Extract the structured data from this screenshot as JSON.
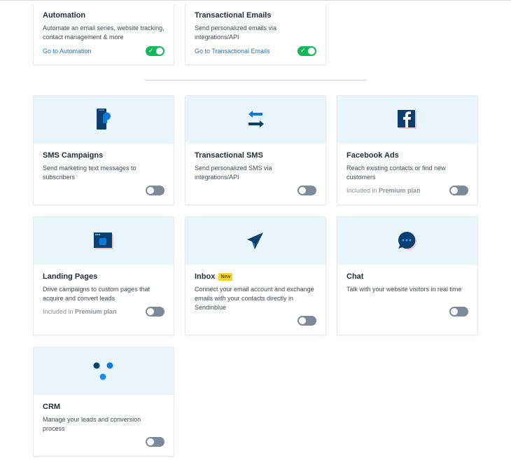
{
  "top_cards": [
    {
      "title": "Automation",
      "desc": "Automate an email series, website tracking, contact management & more",
      "link": "Go to Automation",
      "enabled": true
    },
    {
      "title": "Transactional Emails",
      "desc": "Send personalized emails via integrations/API",
      "link": "Go to Transactional Emails",
      "enabled": true
    }
  ],
  "cards": [
    {
      "title": "SMS Campaigns",
      "desc": "Send marketing text messages to subscribers",
      "icon": "phone-sms-icon",
      "enabled": false
    },
    {
      "title": "Transactional SMS",
      "desc": "Send personalized SMS via integrations/API",
      "icon": "arrows-exchange-icon",
      "enabled": false
    },
    {
      "title": "Facebook Ads",
      "desc": "Reach existing contacts or find new customers",
      "premium_prefix": "Included in ",
      "premium_plan": "Premium plan",
      "icon": "facebook-icon",
      "enabled": false
    },
    {
      "title": "Landing Pages",
      "desc": "Drive campaigns to custom pages that acquire and convert leads",
      "premium_prefix": "Included in ",
      "premium_plan": "Premium plan",
      "icon": "browser-window-icon",
      "enabled": false
    },
    {
      "title": "Inbox",
      "badge": "New",
      "desc": "Connect your email account and exchange emails with your contacts directly in Sendinblue",
      "icon": "paper-plane-icon",
      "enabled": false
    },
    {
      "title": "Chat",
      "desc": "Talk with your website visitors in real time",
      "icon": "chat-bubble-icon",
      "enabled": false
    },
    {
      "title": "CRM",
      "desc": "Manage your leads and conversion process",
      "icon": "crm-dots-icon",
      "enabled": false
    }
  ],
  "colors": {
    "accent": "#0b7bd6",
    "toggle_on": "#13b85a",
    "toggle_off": "#7d8a99",
    "banner": "#eaf4fb",
    "navy": "#0b4a7a"
  }
}
